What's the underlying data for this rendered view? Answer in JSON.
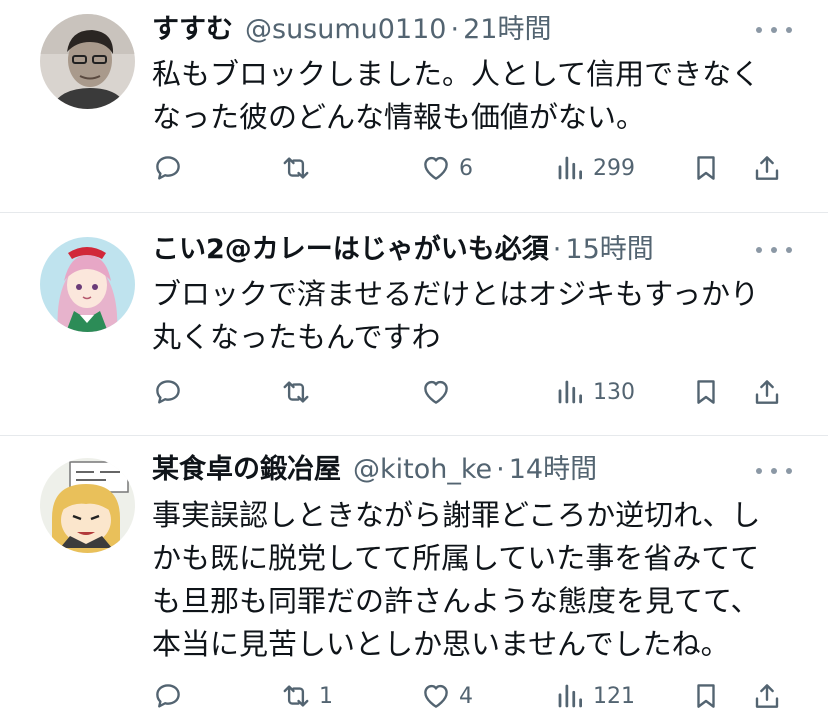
{
  "tweets": [
    {
      "name": "すすむ",
      "handle": "@susumu0110",
      "separator": "·",
      "time": "21時間",
      "text_lines": [
        "私もブロックしました。人として信用できなく",
        "なった彼のどんな情報も価値がない。"
      ],
      "retweets": "",
      "likes": "6",
      "views": "299",
      "avatar": "photo-man-glasses"
    },
    {
      "name": "こい2@カレーはじゃがいも必須",
      "handle": "",
      "separator": "·",
      "time": "15時間",
      "text_lines": [
        "ブロックで済ませるだけとはオジキもすっかり",
        "丸くなったもんですわ"
      ],
      "retweets": "",
      "likes": "",
      "views": "130",
      "avatar": "anime-girl-pink-hair"
    },
    {
      "name": "某食卓の鍛冶屋",
      "handle": "@kitoh_ke",
      "separator": "·",
      "time": "14時間",
      "text_lines": [
        "事実誤認しときながら謝罪どころか逆切れ、し",
        "かも既に脱党してて所属していた事を省みてて",
        "も旦那も同罪だの許さんような態度を見てて、",
        "本当に見苦しいとしか思いませんでしたね。"
      ],
      "retweets": "1",
      "likes": "4",
      "views": "121",
      "avatar": "cartoon-boy-sign"
    }
  ],
  "icons": [
    "reply-icon",
    "retweet-icon",
    "like-icon",
    "views-icon",
    "bookmark-icon",
    "share-icon"
  ],
  "colors": {
    "text": "#0f1419",
    "secondary": "#536471",
    "divider": "#e6e9ec"
  }
}
